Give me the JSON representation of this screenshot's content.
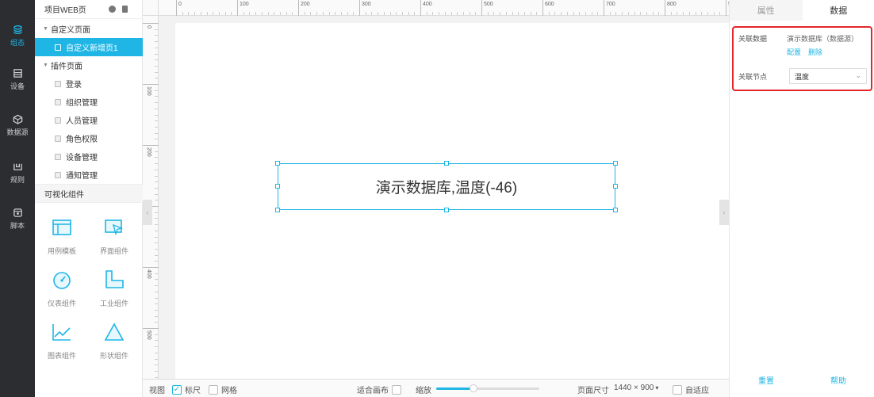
{
  "rail": [
    {
      "label": "组态",
      "icon": "layers-icon",
      "active": true
    },
    {
      "label": "设备",
      "icon": "device-icon",
      "active": false
    },
    {
      "label": "数据源",
      "icon": "cube-icon",
      "active": false
    },
    {
      "label": "规则",
      "icon": "rule-icon",
      "active": false
    },
    {
      "label": "脚本",
      "icon": "script-icon",
      "active": false
    }
  ],
  "tree": {
    "title": "项目WEB页",
    "custom_group": "自定义页面",
    "custom_pages": [
      "自定义新增页1"
    ],
    "plugin_group": "插件页面",
    "plugin_pages": [
      "登录",
      "组织管理",
      "人员管理",
      "角色权限",
      "设备管理",
      "通知管理"
    ],
    "components_title": "可视化组件",
    "components": [
      "用例模板",
      "界面组件",
      "仪表组件",
      "工业组件",
      "图表组件",
      "形状组件"
    ]
  },
  "ruler": {
    "h_labels": [
      "0",
      "100",
      "200",
      "300",
      "400",
      "500",
      "600",
      "700",
      "800",
      "90"
    ],
    "v_labels": [
      "0",
      "100",
      "200",
      "300",
      "400",
      "500"
    ]
  },
  "canvas": {
    "widget_text": "演示数据库,温度(-46)"
  },
  "bottom": {
    "view": "视图",
    "ruler": "标尺",
    "grid": "网格",
    "fit": "适合画布",
    "zoom": "缩放",
    "zoom_level": 0.36,
    "page_size_label": "页面尺寸",
    "page_size": "1440 × 900",
    "adaptive": "自适应"
  },
  "panel": {
    "tab_props": "属性",
    "tab_data": "数据",
    "assoc_data_label": "关联数据",
    "assoc_data_value": "演示数据库（数据源）",
    "config": "配置",
    "delete": "删除",
    "assoc_node_label": "关联节点",
    "assoc_node_value": "温度",
    "reset": "重置",
    "help": "帮助"
  },
  "colors": {
    "accent": "#1fb6e6",
    "highlight": "#e5262b",
    "rail": "#2b2d31"
  }
}
